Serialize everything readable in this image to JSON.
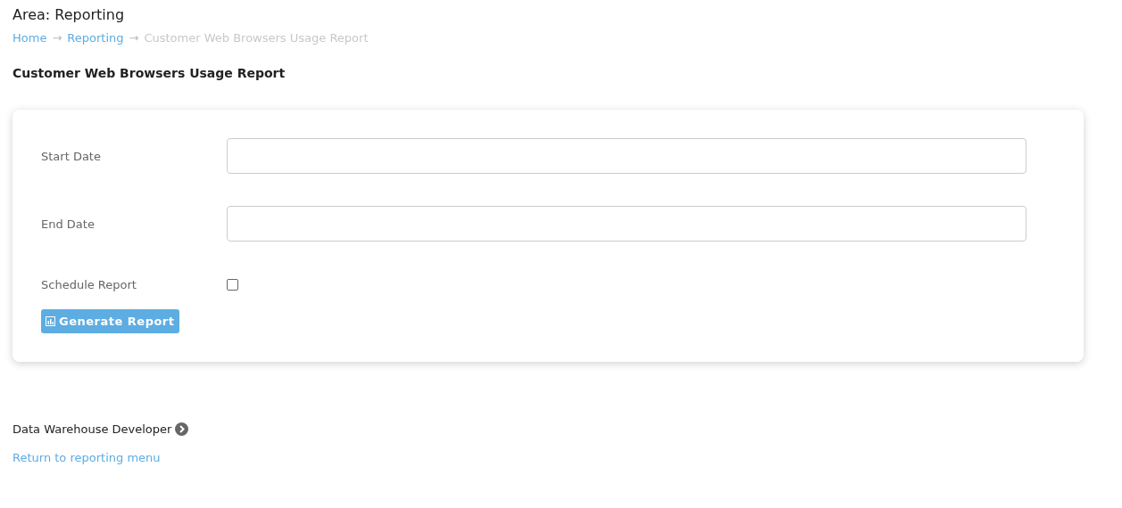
{
  "area_title": "Area: Reporting",
  "breadcrumb": [
    {
      "label": "Home",
      "kind": "link"
    },
    {
      "label": "→",
      "kind": "separator"
    },
    {
      "label": "Reporting",
      "kind": "link"
    },
    {
      "label": "→",
      "kind": "separator"
    },
    {
      "label": "Customer Web Browsers Usage Report",
      "kind": "current"
    }
  ],
  "heading": "Customer Web Browsers Usage Report",
  "form": {
    "fields": [
      {
        "label": "Start Date",
        "kind": "text"
      },
      {
        "label": "End Date",
        "kind": "text"
      },
      {
        "label": "Schedule Report",
        "kind": "checkbox",
        "checked": false
      }
    ],
    "button": "Generate Report"
  },
  "footer": {
    "owner": "Data Warehouse Developer",
    "link": "Return to reporting menu"
  }
}
